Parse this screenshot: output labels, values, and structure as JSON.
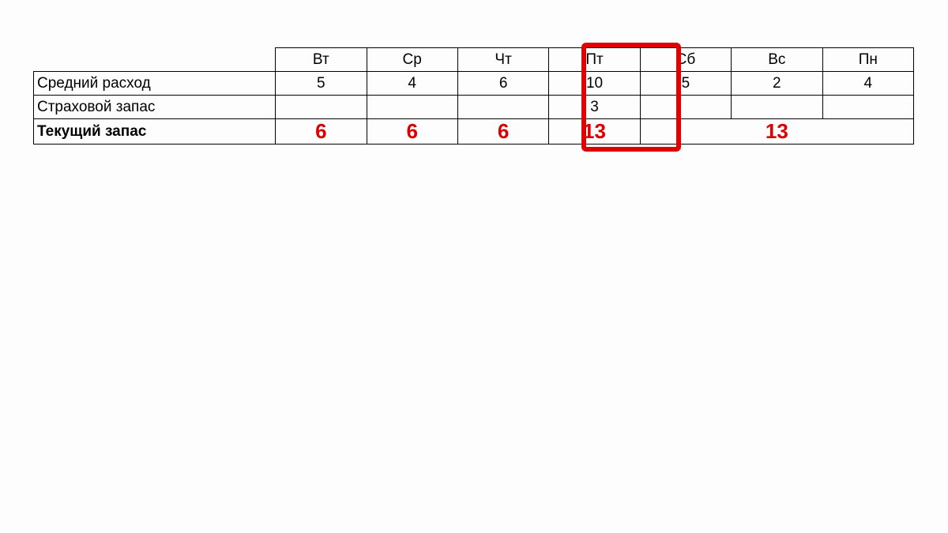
{
  "headers": [
    "Вт",
    "Ср",
    "Чт",
    "Пт",
    "Сб",
    "Вс",
    "Пн"
  ],
  "rows": {
    "avg": {
      "label": "Средний расход",
      "values": [
        "5",
        "4",
        "6",
        "10",
        "5",
        "2",
        "4"
      ]
    },
    "safety": {
      "label": "Страховой запас",
      "values": [
        "",
        "",
        "",
        "3",
        "",
        "",
        ""
      ]
    },
    "current": {
      "label": "Текущий запас",
      "group1": "6",
      "group1b": "6",
      "group1c": "6",
      "val_pt": "13",
      "group2": "13"
    }
  },
  "highlight_column_index": 3,
  "chart_data": {
    "type": "table",
    "title": "",
    "columns": [
      "",
      "Вт",
      "Ср",
      "Чт",
      "Пт",
      "Сб",
      "Вс",
      "Пн"
    ],
    "rows": [
      {
        "label": "Средний расход",
        "values": [
          5,
          4,
          6,
          10,
          5,
          2,
          4
        ]
      },
      {
        "label": "Страховой запас",
        "values": [
          null,
          null,
          null,
          3,
          null,
          null,
          null
        ]
      },
      {
        "label": "Текущий запас",
        "values": [
          6,
          6,
          6,
          13,
          null,
          13,
          null
        ],
        "note": "values in red; 6 spans Вт-Чт visually, 13 at Пт highlighted, 13 spans Сб-Пн visually"
      }
    ],
    "highlight": {
      "column": "Пт",
      "style": "red-box"
    }
  }
}
